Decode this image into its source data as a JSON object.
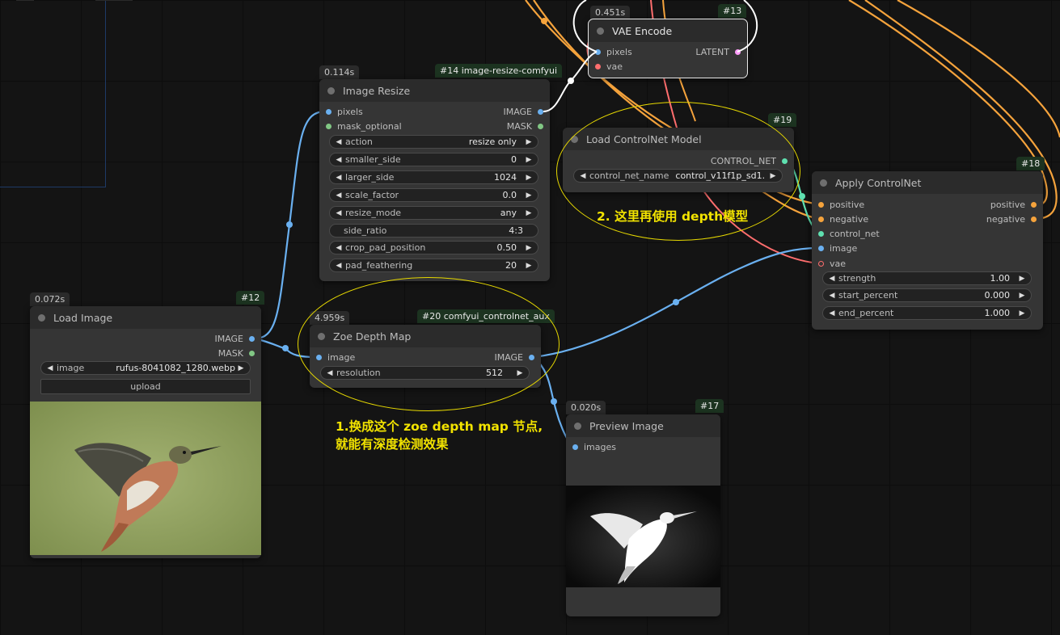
{
  "colors": {
    "image_wire": "#6ab0f0",
    "conditioning_wire": "#f5a33c",
    "vae_wire": "#ff6e6e",
    "latent_pin": "#ff9cf9",
    "controlnet_pin": "#5fe0b0",
    "mask_pin": "#81c784",
    "annotation": "#f2e300"
  },
  "nodes": {
    "load_image": {
      "time": "0.072s",
      "id": "#12",
      "title": "Load Image",
      "outputs": [
        "IMAGE",
        "MASK"
      ],
      "widget_label": "image",
      "widget_value": "rufus-8041082_1280.webp",
      "upload_label": "upload",
      "preview_icon": "hummingbird-photo"
    },
    "image_resize": {
      "time": "0.114s",
      "id": "#14 image-resize-comfyui",
      "title": "Image Resize",
      "inputs": [
        "pixels",
        "mask_optional"
      ],
      "outputs": [
        "IMAGE",
        "MASK"
      ],
      "widgets": [
        {
          "label": "action",
          "value": "resize only",
          "arrows": true
        },
        {
          "label": "smaller_side",
          "value": "0",
          "arrows": true
        },
        {
          "label": "larger_side",
          "value": "1024",
          "arrows": true
        },
        {
          "label": "scale_factor",
          "value": "0.0",
          "arrows": true
        },
        {
          "label": "resize_mode",
          "value": "any",
          "arrows": true
        },
        {
          "label": "side_ratio",
          "value": "4:3",
          "arrows": false
        },
        {
          "label": "crop_pad_position",
          "value": "0.50",
          "arrows": true
        },
        {
          "label": "pad_feathering",
          "value": "20",
          "arrows": true
        }
      ]
    },
    "vae_encode": {
      "time": "0.451s",
      "id": "#13",
      "title": "VAE Encode",
      "inputs": [
        "pixels",
        "vae"
      ],
      "outputs": [
        "LATENT"
      ]
    },
    "controlnet_loader": {
      "id": "#19",
      "title": "Load ControlNet Model",
      "outputs": [
        "CONTROL_NET"
      ],
      "widget_label": "control_net_name",
      "widget_value": "control_v11f1p_sd1..."
    },
    "apply_controlnet": {
      "id": "#18",
      "title": "Apply ControlNet",
      "inputs": [
        "positive",
        "negative",
        "control_net",
        "image",
        "vae"
      ],
      "outputs": [
        "positive",
        "negative"
      ],
      "widgets": [
        {
          "label": "strength",
          "value": "1.00"
        },
        {
          "label": "start_percent",
          "value": "0.000"
        },
        {
          "label": "end_percent",
          "value": "1.000"
        }
      ]
    },
    "zoe_depth": {
      "time": "4.959s",
      "id": "#20 comfyui_controlnet_aux",
      "title": "Zoe Depth Map",
      "inputs": [
        "image"
      ],
      "outputs": [
        "IMAGE"
      ],
      "widget_label": "resolution",
      "widget_value": "512"
    },
    "preview_image": {
      "time": "0.020s",
      "id": "#17",
      "title": "Preview Image",
      "inputs": [
        "images"
      ],
      "preview_icon": "depth-map-hummingbird"
    }
  },
  "annotations": {
    "note1_line1": "1.换成这个 zoe depth map 节点,",
    "note1_line2": "就能有深度检测效果",
    "note2": "2. 这里再使用 depth模型"
  }
}
